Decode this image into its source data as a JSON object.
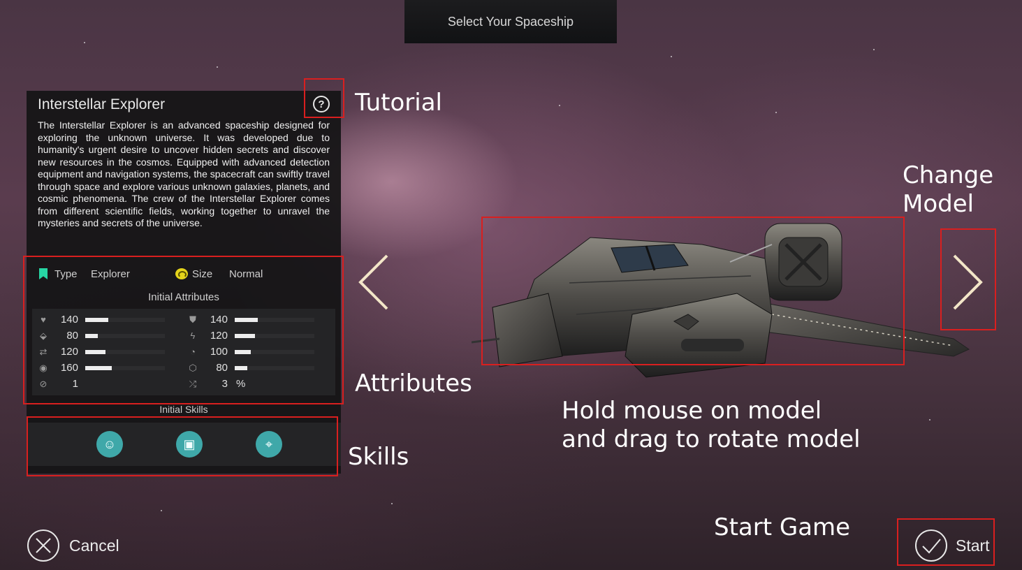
{
  "title": "Select Your Spaceship",
  "ship": {
    "name": "Interstellar Explorer",
    "description": "The Interstellar Explorer is an advanced spaceship designed for exploring the unknown universe. It was developed due to humanity's urgent desire to uncover hidden secrets and discover new resources in the cosmos. Equipped with advanced detection equipment and navigation systems, the spacecraft can swiftly travel through space and explore various unknown galaxies, planets, and cosmic phenomena. The crew of the Interstellar Explorer comes from different scientific fields, working together to unravel the mysteries and secrets of the universe.",
    "type_label": "Type",
    "type_value": "Explorer",
    "size_label": "Size",
    "size_value": "Normal",
    "attributes_heading": "Initial Attributes",
    "attributes_left": [
      {
        "icon": "heart-icon",
        "value": "140",
        "level": 0.29
      },
      {
        "icon": "tag-icon",
        "value": "80",
        "level": 0.16
      },
      {
        "icon": "speed-icon",
        "value": "120",
        "level": 0.25
      },
      {
        "icon": "eye-icon",
        "value": "160",
        "level": 0.33
      },
      {
        "icon": "cycle-icon",
        "value": "1"
      }
    ],
    "attributes_right": [
      {
        "icon": "shield-icon",
        "value": "140",
        "level": 0.29
      },
      {
        "icon": "bolt-icon",
        "value": "120",
        "level": 0.25
      },
      {
        "icon": "gauge-icon",
        "value": "100",
        "level": 0.2
      },
      {
        "icon": "cube-icon",
        "value": "80",
        "level": 0.16
      },
      {
        "icon": "shuffle-icon",
        "value": "3",
        "unit": "%"
      }
    ],
    "skills_heading": "Initial Skills",
    "skills": [
      {
        "icon": "alien-chat-skill-icon"
      },
      {
        "icon": "device-skill-icon"
      },
      {
        "icon": "ufo-scan-skill-icon"
      }
    ]
  },
  "annotations": {
    "tutorial": "Tutorial",
    "attributes": "Attributes",
    "skills": "Skills",
    "change_model_line1": "Change",
    "change_model_line2": "Model",
    "rotate_line1": "Hold mouse on model",
    "rotate_line2": "and drag to rotate model",
    "start_game": "Start Game"
  },
  "buttons": {
    "cancel": "Cancel",
    "start": "Start",
    "help_symbol": "?"
  },
  "colors": {
    "accent_teal": "#3fa8a9",
    "annotation_red": "#d91f1f",
    "type_flag": "#27d6a4",
    "size_icon": "#e5d41b",
    "arrow_cream": "#f3e6c8"
  }
}
